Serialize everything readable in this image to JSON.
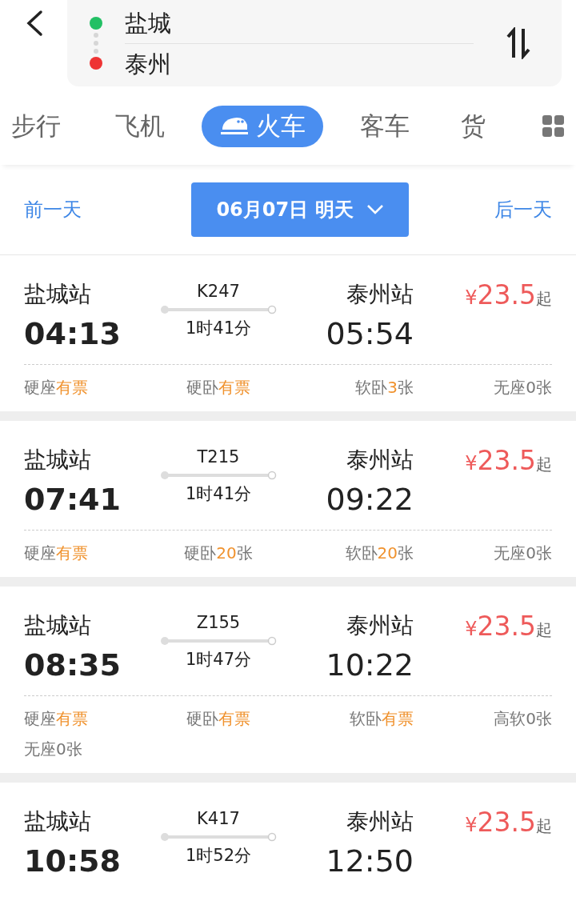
{
  "route": {
    "from": "盐城",
    "to": "泰州"
  },
  "tabs": [
    {
      "label": "步行",
      "selected": false
    },
    {
      "label": "飞机",
      "selected": false
    },
    {
      "label": "火车",
      "selected": true
    },
    {
      "label": "客车",
      "selected": false
    },
    {
      "label": "货",
      "selected": false
    }
  ],
  "date_bar": {
    "prev": "前一天",
    "date": "06月07日 明天",
    "next": "后一天"
  },
  "trains": [
    {
      "from": "盐城站",
      "depart": "04:13",
      "number": "K247",
      "duration": "1时41分",
      "to": "泰州站",
      "arrive": "05:54",
      "price": {
        "currency": "¥",
        "amount": "23.5",
        "suffix": "起"
      },
      "seats": [
        {
          "name": "硬座",
          "count": "有票",
          "available": true
        },
        {
          "name": "硬卧",
          "count": "有票",
          "available": true
        },
        {
          "name": "软卧",
          "count": "3",
          "unit": "张",
          "available": true
        },
        {
          "name": "无座",
          "count": "0",
          "unit": "张",
          "available": false
        }
      ]
    },
    {
      "from": "盐城站",
      "depart": "07:41",
      "number": "T215",
      "duration": "1时41分",
      "to": "泰州站",
      "arrive": "09:22",
      "price": {
        "currency": "¥",
        "amount": "23.5",
        "suffix": "起"
      },
      "seats": [
        {
          "name": "硬座",
          "count": "有票",
          "available": true
        },
        {
          "name": "硬卧",
          "count": "20",
          "unit": "张",
          "available": true
        },
        {
          "name": "软卧",
          "count": "20",
          "unit": "张",
          "available": true
        },
        {
          "name": "无座",
          "count": "0",
          "unit": "张",
          "available": false
        }
      ]
    },
    {
      "from": "盐城站",
      "depart": "08:35",
      "number": "Z155",
      "duration": "1时47分",
      "to": "泰州站",
      "arrive": "10:22",
      "price": {
        "currency": "¥",
        "amount": "23.5",
        "suffix": "起"
      },
      "seats": [
        {
          "name": "硬座",
          "count": "有票",
          "available": true
        },
        {
          "name": "硬卧",
          "count": "有票",
          "available": true
        },
        {
          "name": "软卧",
          "count": "有票",
          "available": true
        },
        {
          "name": "高软",
          "count": "0",
          "unit": "张",
          "available": false
        },
        {
          "name": "无座",
          "count": "0",
          "unit": "张",
          "available": false
        }
      ]
    },
    {
      "from": "盐城站",
      "depart": "10:58",
      "number": "K417",
      "duration": "1时52分",
      "to": "泰州站",
      "arrive": "12:50",
      "price": {
        "currency": "¥",
        "amount": "23.5",
        "suffix": "起"
      }
    }
  ]
}
